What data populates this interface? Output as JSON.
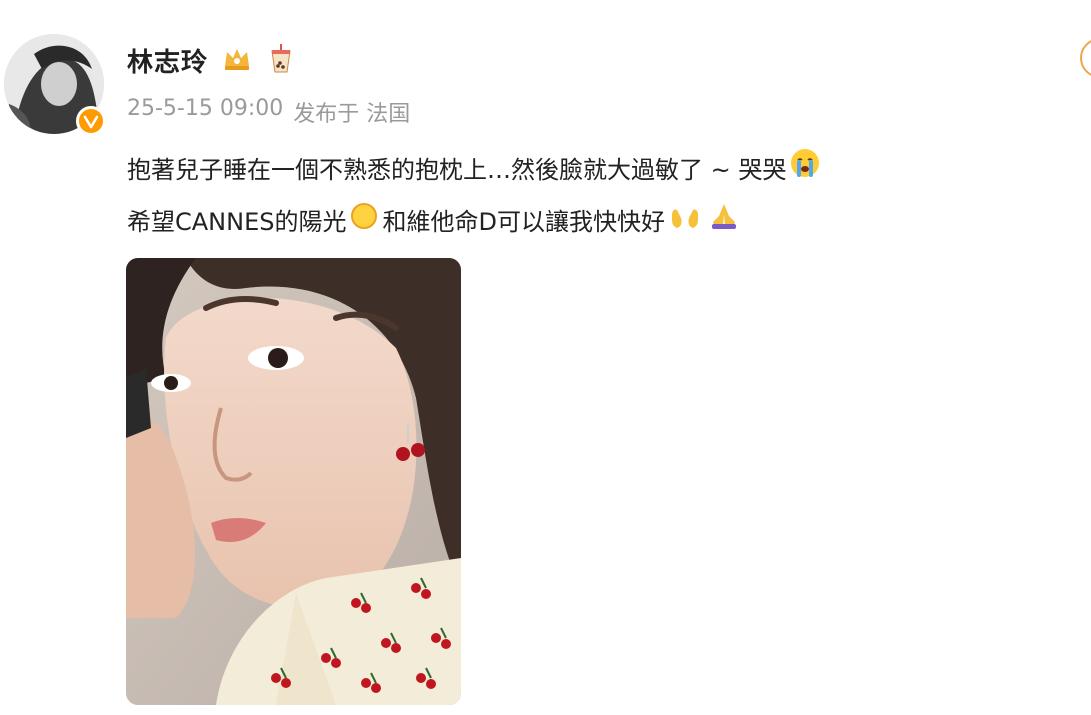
{
  "user": {
    "name": "林志玲",
    "verified": true,
    "badge_icons": [
      "crown-badge-icon",
      "bubble-tea-icon"
    ]
  },
  "meta": {
    "timestamp": "25-5-15 09:00",
    "location": "发布于 法国"
  },
  "post": {
    "line1_text": "抱著兒子睡在一個不熟悉的抱枕上…然後臉就大過敏了 ~ 哭哭",
    "line1_emoji": "crying-face-icon",
    "line2_part1": "希望CANNES的陽光",
    "line2_emoji1": "sun-icon",
    "line2_part2": "和維他命D可以讓我快快好",
    "line2_emoji2": "open-hands-icon",
    "line2_emoji3": "praying-hands-icon"
  },
  "image": {
    "subject": "photo-selfie"
  },
  "colors": {
    "accent_orange": "#ff9a00",
    "meta_gray": "#9a9a9a",
    "text": "#222222"
  }
}
